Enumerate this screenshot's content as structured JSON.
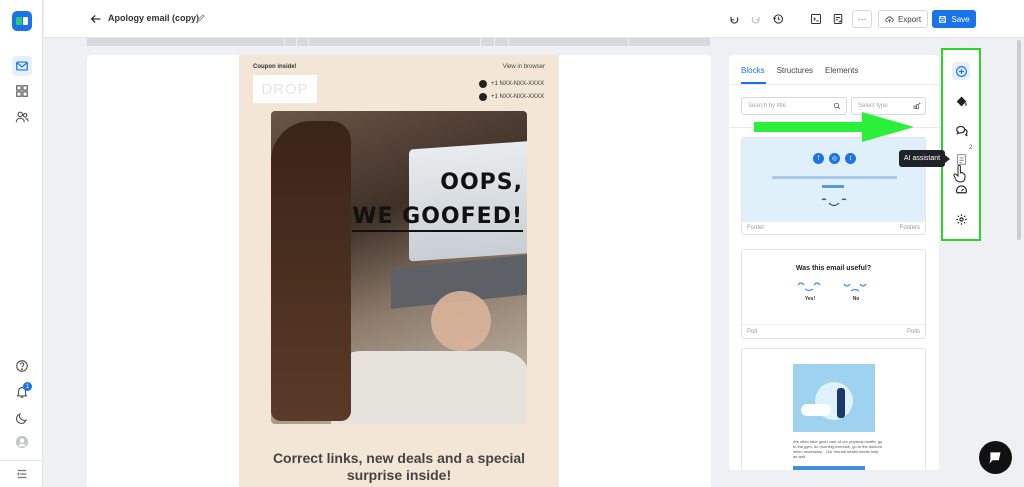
{
  "header": {
    "title": "Apology email (copy)",
    "more_label": "···",
    "export_label": "Export",
    "save_label": "Save"
  },
  "email": {
    "coupon_text": "Coupon inside!",
    "view_in_browser": "View in browser",
    "logo_text": "DROP",
    "phones": [
      "+1 NXX-NXX-XXXX",
      "+1 NXX-NXX-XXXX"
    ],
    "hero_line1": "OOPS,",
    "hero_line2": "WE GOOFED!",
    "headline": "Correct links, new deals and a special surprise inside!"
  },
  "panel": {
    "tabs": [
      "Blocks",
      "Structures",
      "Elements"
    ],
    "active_tab": "Blocks",
    "search_placeholder": "Search by title",
    "select_placeholder": "Select type",
    "cards": [
      {
        "name": "Footer",
        "type": "Footers"
      },
      {
        "name": "Poll",
        "type": "Polls",
        "question": "Was this email useful?",
        "options": [
          "Yes!",
          "No"
        ]
      },
      {
        "text": "We often take good care of our physical health: go to the gym, do morning exercise, go to the doctors when necessary... Our mental health needs help as well."
      }
    ]
  },
  "right_toolbar": {
    "badge": "2",
    "tooltip": "AI assistant"
  },
  "left_rail": {
    "notification_count": "1"
  },
  "colors": {
    "accent": "#1a73e8",
    "highlight_border": "#2bd42b",
    "email_bg": "#f3e6d6"
  }
}
